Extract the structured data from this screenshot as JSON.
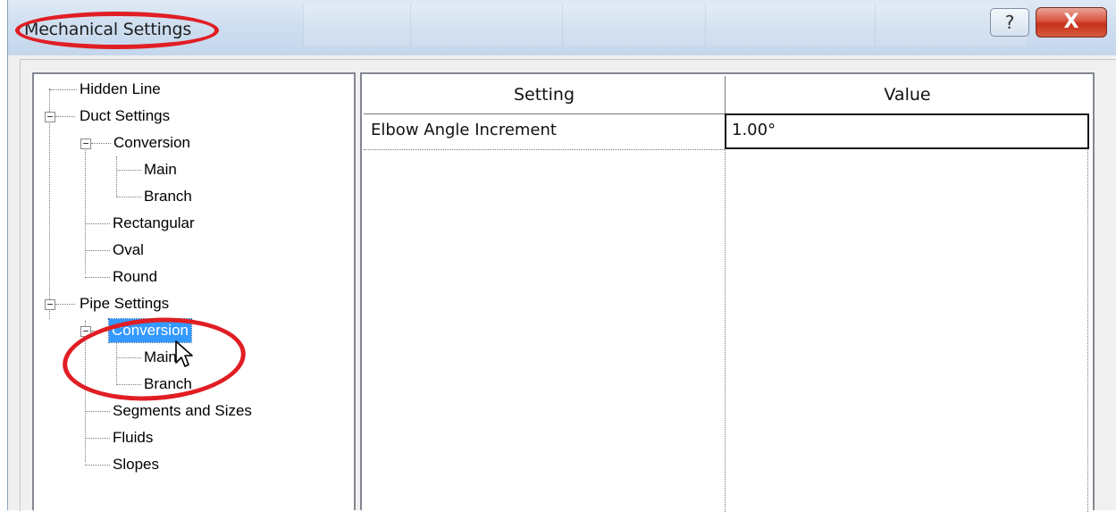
{
  "window": {
    "title": "Mechanical Settings",
    "help_icon": "question-mark-icon",
    "help_glyph": "?",
    "close_icon": "close-x-icon",
    "close_glyph": "X"
  },
  "tree": {
    "items": [
      {
        "label": "Hidden Line",
        "level": 0
      },
      {
        "label": "Duct Settings",
        "level": 0,
        "expander": "−"
      },
      {
        "label": "Conversion",
        "level": 1,
        "expander": "−"
      },
      {
        "label": "Main",
        "level": 2
      },
      {
        "label": "Branch",
        "level": 2
      },
      {
        "label": "Rectangular",
        "level": 1
      },
      {
        "label": "Oval",
        "level": 1
      },
      {
        "label": "Round",
        "level": 1
      },
      {
        "label": "Pipe Settings",
        "level": 0,
        "expander": "−"
      },
      {
        "label": "Conversion",
        "level": 1,
        "expander": "−",
        "selected": true
      },
      {
        "label": "Main",
        "level": 2
      },
      {
        "label": "Branch",
        "level": 2
      },
      {
        "label": "Segments and Sizes",
        "level": 1
      },
      {
        "label": "Fluids",
        "level": 1
      },
      {
        "label": "Slopes",
        "level": 1
      }
    ]
  },
  "grid": {
    "columns": [
      "Setting",
      "Value"
    ],
    "rows": [
      {
        "setting": "Elbow Angle Increment",
        "value": "1.00°"
      }
    ]
  },
  "colors": {
    "selection": "#3399ff",
    "annotation_ring": "#e01e24",
    "close_button": "#c7311c"
  }
}
